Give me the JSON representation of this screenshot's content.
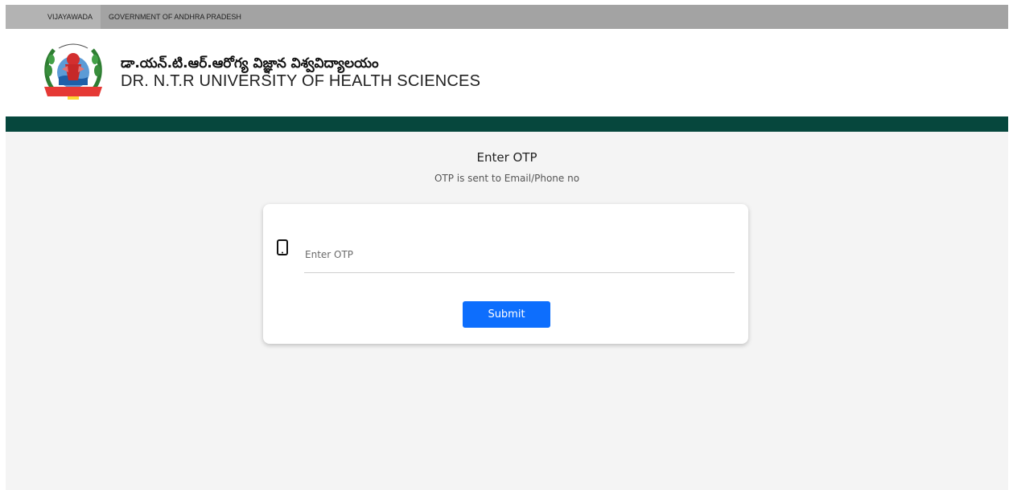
{
  "topbar": {
    "items": [
      {
        "label": "VIJAYAWADA"
      },
      {
        "label": "GOVERNMENT OF ANDHRA PRADESH"
      }
    ]
  },
  "header": {
    "logo_icon": "university-seal-icon",
    "title_telugu": "డా.యన్.టి.ఆర్.ఆరోగ్య విజ్ఞాన విశ్వవిద్యాలయం",
    "title_english": "DR. N.T.R UNIVERSITY OF HEALTH SCIENCES"
  },
  "main": {
    "heading": "Enter OTP",
    "subheading": "OTP is sent to Email/Phone no"
  },
  "form": {
    "phone_icon": "mobile-phone-icon",
    "otp_value": "",
    "otp_placeholder": "Enter OTP",
    "submit_label": "Submit"
  },
  "colors": {
    "brand_green": "#06473d",
    "primary_button": "#0d6efd",
    "topbar": "#a3a3a3",
    "page_background": "#f4f4f4"
  }
}
